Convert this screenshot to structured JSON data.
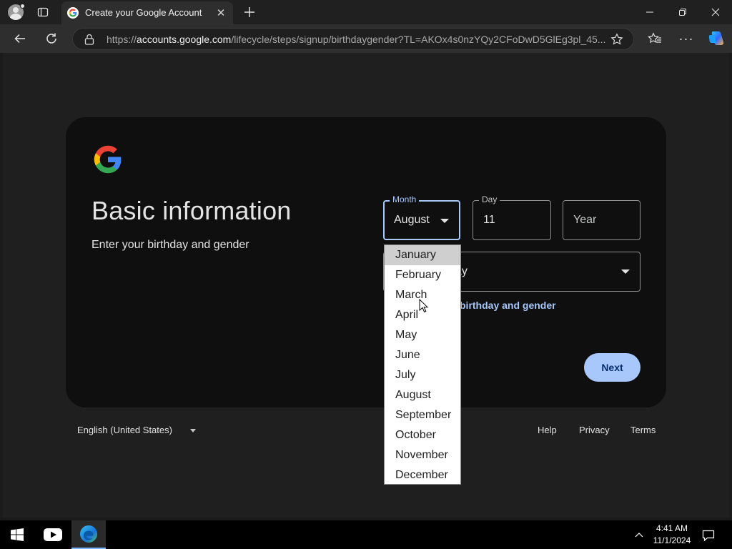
{
  "browser": {
    "tab_title": "Create your Google Account",
    "url_prefix": "https://",
    "url_host": "accounts.google.com",
    "url_path": "/lifecycle/steps/signup/birthdaygender?TL=AKOx4s0nzYQy2CFoDwD5GlEg3pl_45..."
  },
  "page": {
    "heading": "Basic information",
    "subheading": "Enter your birthday and gender",
    "month": {
      "label": "Month",
      "value": "August"
    },
    "day": {
      "label": "Day",
      "value": "11"
    },
    "year": {
      "placeholder": "Year"
    },
    "gender": {
      "value_fragment": "ay"
    },
    "why_link_fragment": "birthday and gender",
    "next_label": "Next",
    "month_options": [
      "January",
      "February",
      "March",
      "April",
      "May",
      "June",
      "July",
      "August",
      "September",
      "October",
      "November",
      "December"
    ],
    "highlighted_option": "January"
  },
  "footer": {
    "language": "English (United States)",
    "help": "Help",
    "privacy": "Privacy",
    "terms": "Terms"
  },
  "taskbar": {
    "time": "4:41 AM",
    "date": "11/1/2024"
  },
  "colors": {
    "accent": "#a8c7fa",
    "card_bg": "#0f0f0f",
    "page_bg": "#1f1f1f"
  }
}
